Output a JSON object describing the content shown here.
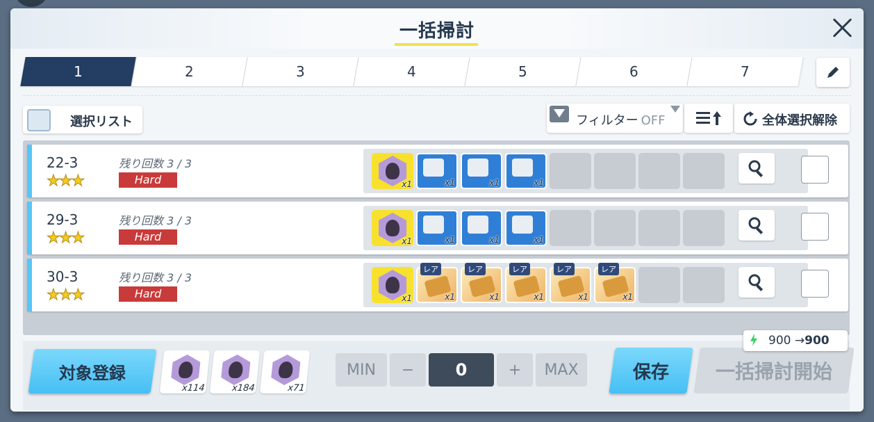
{
  "title": "一括掃討",
  "tabs": [
    "1",
    "2",
    "3",
    "4",
    "5",
    "6",
    "7"
  ],
  "active_tab": "1",
  "select_list_label": "選択リスト",
  "filter": {
    "label": "フィルター",
    "state": "OFF"
  },
  "deselect_all_label": "全体選択解除",
  "stages": [
    {
      "stage": "22-3",
      "stars": "★★★",
      "remaining": "残り回数 3 / 3",
      "difficulty": "Hard",
      "rewards": [
        {
          "kind": "char",
          "count": "x1"
        },
        {
          "kind": "item",
          "count": "x1"
        },
        {
          "kind": "item",
          "count": "x1"
        },
        {
          "kind": "item",
          "count": "x1"
        }
      ]
    },
    {
      "stage": "29-3",
      "stars": "★★★",
      "remaining": "残り回数 3 / 3",
      "difficulty": "Hard",
      "rewards": [
        {
          "kind": "char",
          "count": "x1"
        },
        {
          "kind": "item",
          "count": "x1"
        },
        {
          "kind": "item",
          "count": "x1"
        },
        {
          "kind": "item",
          "count": "x1"
        }
      ]
    },
    {
      "stage": "30-3",
      "stars": "★★★",
      "remaining": "残り回数 3 / 3",
      "difficulty": "Hard",
      "rewards": [
        {
          "kind": "char",
          "count": "x1"
        },
        {
          "kind": "rare",
          "tag": "レア",
          "count": "x1"
        },
        {
          "kind": "rare",
          "tag": "レア",
          "count": "x1"
        },
        {
          "kind": "rare",
          "tag": "レア",
          "count": "x1"
        },
        {
          "kind": "rare",
          "tag": "レア",
          "count": "x1"
        },
        {
          "kind": "rare",
          "tag": "レア",
          "count": "x1"
        }
      ]
    }
  ],
  "register_label": "対象登録",
  "held_counts": [
    "x114",
    "x184",
    "x71"
  ],
  "stepper": {
    "min": "MIN",
    "minus": "−",
    "value": "0",
    "plus": "+",
    "max": "MAX"
  },
  "save_label": "保存",
  "start_label": "一括掃討開始",
  "ap": {
    "from": "900",
    "arrow": "→",
    "to": "900"
  },
  "colors": {
    "accent_blue": "#46bff4",
    "tab_active": "#233d63",
    "hard_red": "#c93a3a",
    "row_accent": "#56c6f4"
  }
}
